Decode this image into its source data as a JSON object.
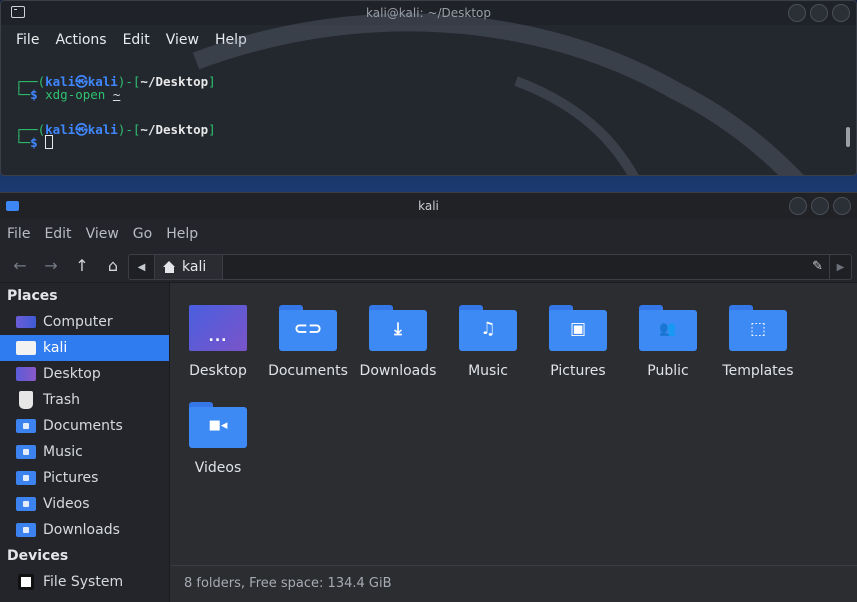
{
  "terminal": {
    "title": "kali@kali: ~/Desktop",
    "menu": [
      "File",
      "Actions",
      "Edit",
      "View",
      "Help"
    ],
    "lines": [
      {
        "user": "kali",
        "host": "kali",
        "cwd": "~/Desktop",
        "command": "xdg-open",
        "arg": "~"
      },
      {
        "user": "kali",
        "host": "kali",
        "cwd": "~/Desktop",
        "command": "",
        "arg": ""
      }
    ],
    "prompt_symbol": "$",
    "at_symbol": "㉿"
  },
  "file_manager": {
    "title": "kali",
    "menu": [
      "File",
      "Edit",
      "View",
      "Go",
      "Help"
    ],
    "path": {
      "crumb": "kali"
    },
    "sidebar": {
      "places_heading": "Places",
      "items": [
        {
          "label": "Computer",
          "icon": "computer-icon",
          "selected": false
        },
        {
          "label": "kali",
          "icon": "home-drive-icon",
          "selected": true
        },
        {
          "label": "Desktop",
          "icon": "desktop-icon",
          "selected": false
        },
        {
          "label": "Trash",
          "icon": "trash-icon",
          "selected": false
        },
        {
          "label": "Documents",
          "icon": "documents-folder-icon",
          "selected": false
        },
        {
          "label": "Music",
          "icon": "music-folder-icon",
          "selected": false
        },
        {
          "label": "Pictures",
          "icon": "pictures-folder-icon",
          "selected": false
        },
        {
          "label": "Videos",
          "icon": "videos-folder-icon",
          "selected": false
        },
        {
          "label": "Downloads",
          "icon": "downloads-folder-icon",
          "selected": false
        }
      ],
      "devices_heading": "Devices",
      "devices": [
        {
          "label": "File System",
          "icon": "disk-icon"
        }
      ]
    },
    "folders": [
      {
        "label": "Desktop",
        "glyph": ""
      },
      {
        "label": "Documents",
        "glyph": "⊂⊃"
      },
      {
        "label": "Downloads",
        "glyph": "⤓"
      },
      {
        "label": "Music",
        "glyph": "♫"
      },
      {
        "label": "Pictures",
        "glyph": "▣"
      },
      {
        "label": "Public",
        "glyph": "👥"
      },
      {
        "label": "Templates",
        "glyph": "⬚"
      },
      {
        "label": "Videos",
        "glyph": "■◂"
      }
    ],
    "status": "8 folders, Free space: 134.4 GiB"
  },
  "colors": {
    "accent": "#2f7cf0",
    "folder": "#3e8af5",
    "prompt_blue": "#3f88ff",
    "prompt_green": "#2ec26f"
  }
}
